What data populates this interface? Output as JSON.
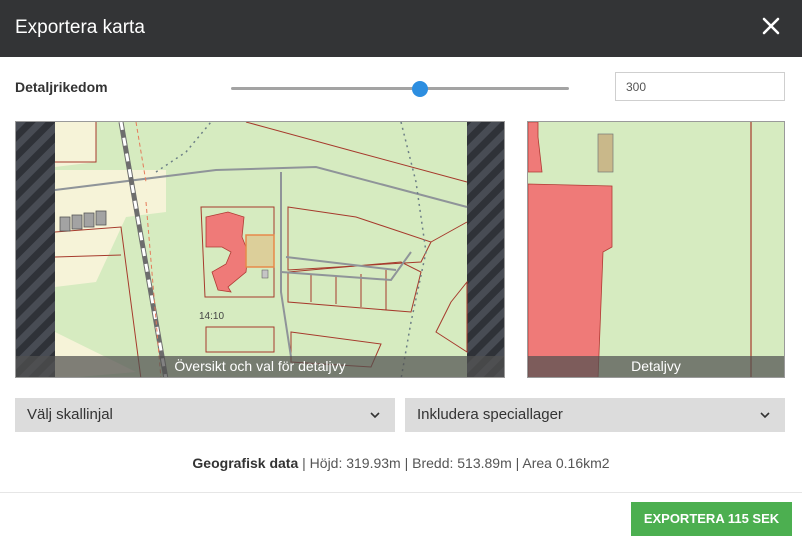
{
  "dialog": {
    "title": "Exportera karta",
    "close_icon": "close-icon"
  },
  "detail": {
    "label": "Detaljrikedom",
    "slider_value_fraction": 0.56,
    "input_value": "300"
  },
  "maps": {
    "overview_caption": "Översikt och val för detaljvy",
    "overview_label": "14:10",
    "detail_caption": "Detaljvy"
  },
  "selects": {
    "scale_label": "Välj skallinjal",
    "layers_label": "Inkludera speciallager"
  },
  "geo": {
    "title": "Geografisk data",
    "values": " | Höjd: 319.93m | Bredd: 513.89m | Area 0.16km2"
  },
  "footer": {
    "export_label": "EXPORTERA 115 SEK"
  },
  "colors": {
    "header_bg": "#333436",
    "accent_blue": "#2d8ee0",
    "export_green": "#4caf50",
    "map_green": "#d6ebc0",
    "building_red": "#ef7a78"
  }
}
